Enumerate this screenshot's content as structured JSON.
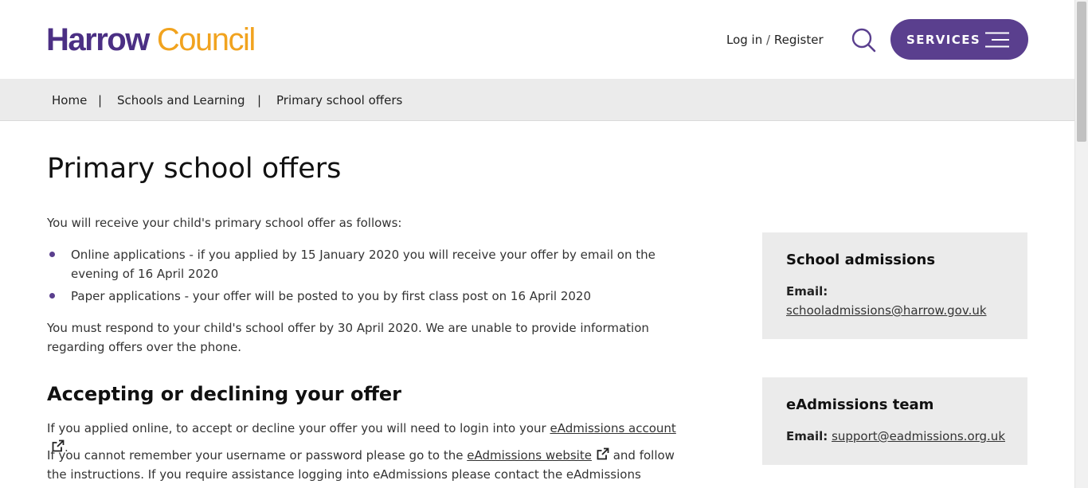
{
  "header": {
    "logo_primary": "Harrow",
    "logo_secondary": "Council",
    "login_label": "Log in",
    "login_separator": "/",
    "register_label": "Register",
    "services_label": "SERVICES",
    "search_icon": "search-icon",
    "menu_icon": "hamburger-menu-icon"
  },
  "breadcrumb": {
    "items": [
      "Home",
      "Schools and Learning",
      "Primary school offers"
    ],
    "separator": "|"
  },
  "main": {
    "title": "Primary school offers",
    "intro": "You will receive your child's primary school offer as follows:",
    "bullets": [
      "Online applications - if you applied by 15 January 2020 you will receive your offer by email on the evening of 16 April 2020",
      "Paper applications - your offer will be posted to you by first class post on 16 April 2020"
    ],
    "respond_text": "You must respond to your child's school offer by 30 April 2020. We are unable to provide information regarding offers over the phone.",
    "section_heading": "Accepting or declining your offer",
    "accept_text_before": "If you applied online, to accept or decline your offer you will need to login into your ",
    "accept_link": "eAdmissions account",
    "accept_text_after": ".",
    "forgot_text_before": "If you cannot remember your username or password please go to the ",
    "forgot_link": "eAdmissions website",
    "forgot_text_after": " and follow the instructions. If you require assistance logging into eAdmissions please contact the eAdmissions team."
  },
  "sidebar": {
    "cards": [
      {
        "title": "School admissions",
        "email_label": "Email:",
        "email": "schooladmissions@harrow.gov.uk"
      },
      {
        "title": "eAdmissions team",
        "email_label": "Email:",
        "email": "support@eadmissions.org.uk"
      }
    ]
  },
  "colors": {
    "brand_purple": "#4b2f84",
    "brand_orange": "#f1a31f",
    "button_purple": "#5a3f8e",
    "breadcrumb_bg": "#ebebeb",
    "card_bg": "#ebebeb"
  }
}
